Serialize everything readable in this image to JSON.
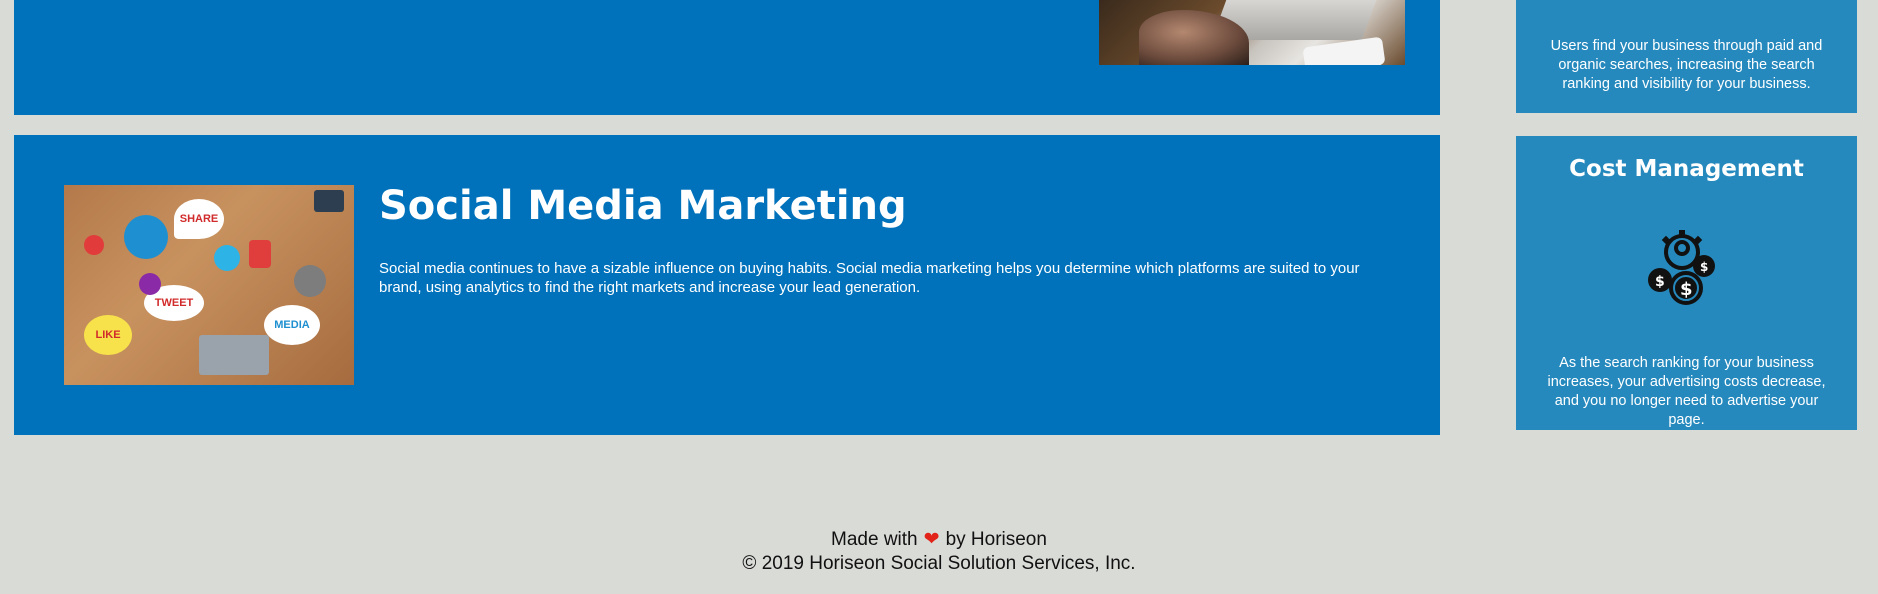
{
  "social_media": {
    "title": "Social Media Marketing",
    "text": "Social media continues to have a sizable influence on buying habits. Social media marketing helps you determine which platforms are suited to your brand, using analytics to find the right markets and increase your lead generation.",
    "image_words": [
      "SHARE",
      "TWEET",
      "LIKE",
      "MEDIA"
    ]
  },
  "benefits": {
    "top_text": "Users find your business through paid and organic searches, increasing the search ranking and visibility for your business.",
    "cost": {
      "title": "Cost Management",
      "icon": "cost-management-icon",
      "text": "As the search ranking for your business increases, your advertising costs decrease, and you no longer need to advertise your page."
    }
  },
  "footer": {
    "made_with": "Made with",
    "by": "by Horiseon",
    "copyright": "© 2019 Horiseon Social Solution Services, Inc."
  },
  "colors": {
    "content_blue": "#0072bb",
    "benefit_blue": "#2589bd",
    "background": "#d9dbd7",
    "heart": "#e2231a"
  }
}
